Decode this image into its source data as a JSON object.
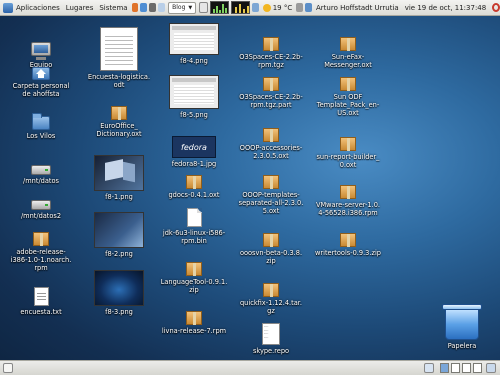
{
  "top_panel": {
    "menus": [
      "Aplicaciones",
      "Lugares",
      "Sistema"
    ],
    "combo_value": "Blog",
    "temperature": "19 °C",
    "user": "Arturo Hoffstadt Urrutia",
    "datetime": "vie 19 de oct, 11:37:48"
  },
  "desktop": {
    "col1": [
      {
        "label": "Equipo",
        "icon": "computer-icon"
      },
      {
        "label": "Carpeta personal\nde ahoffsta",
        "icon": "home-folder-icon"
      },
      {
        "label": "Los Vilos",
        "icon": "folder-icon"
      },
      {
        "label": "/mnt/datos",
        "icon": "drive-icon"
      },
      {
        "label": "/mnt/datos2",
        "icon": "drive-icon"
      },
      {
        "label": "adobe-release-\ni386-1.0-1.noarch.\nrpm",
        "icon": "package-icon"
      },
      {
        "label": "encuesta.txt",
        "icon": "text-file-icon"
      }
    ],
    "col2": [
      {
        "label": "Encuesta-logistica.\nodt",
        "icon": "document-icon"
      },
      {
        "label": "EuroOffice_\nDictionary.oxt",
        "icon": "package-icon"
      },
      {
        "label": "f8-1.png",
        "icon": "image-icon"
      },
      {
        "label": "f8-2.png",
        "icon": "image-icon"
      },
      {
        "label": "f8-3.png",
        "icon": "image-icon"
      }
    ],
    "col3": [
      {
        "label": "f8-4.png",
        "icon": "image-icon"
      },
      {
        "label": "f8-5.png",
        "icon": "image-icon"
      },
      {
        "label": "fedora8-1.jpg",
        "icon": "image-icon",
        "logo_text": "fedora"
      },
      {
        "label": "gdocs-0.4.1.oxt",
        "icon": "package-icon"
      },
      {
        "label": "jdk-6u3-linux-i586-\nrpm.bin",
        "icon": "binary-file-icon"
      },
      {
        "label": "LanguageTool-0.9.1.\nzip",
        "icon": "package-icon"
      },
      {
        "label": "livna-release-7.rpm",
        "icon": "package-icon"
      }
    ],
    "col4": [
      {
        "label": "O3Spaces-CE-2.2b-\nrpm.tgz",
        "icon": "package-icon"
      },
      {
        "label": "O3Spaces-CE-2.2b-\nrpm.tgz.part",
        "icon": "package-icon"
      },
      {
        "label": "OOOP-accessories-\n2.3.0.5.oxt",
        "icon": "package-icon"
      },
      {
        "label": "OOOP-templates-\nseparated-all-2.3.0.\n5.oxt",
        "icon": "package-icon"
      },
      {
        "label": "ooosvn-beta-0.3.8.\nzip",
        "icon": "package-icon"
      },
      {
        "label": "quickfix-1.12.4.tar.\ngz",
        "icon": "package-icon"
      },
      {
        "label": "skype.repo",
        "icon": "text-file-icon"
      }
    ],
    "col5": [
      {
        "label": "Sun-eFax-\nMessenger.oxt",
        "icon": "package-icon"
      },
      {
        "label": "Sun ODF\nTemplate_Pack_en-\nUS.oxt",
        "icon": "package-icon"
      },
      {
        "label": "sun-report-builder_\n0.oxt",
        "icon": "package-icon"
      },
      {
        "label": "VMware-server-1.0.\n4-56528.i386.rpm",
        "icon": "package-icon"
      },
      {
        "label": "writertools-0.9.3.zip",
        "icon": "package-icon"
      }
    ],
    "trash": {
      "label": "Papelera",
      "icon": "trash-icon"
    }
  },
  "colors": {
    "panel": "#dcdcd6",
    "desktop_bg": "#1d4a78",
    "folder": "#e9a840"
  }
}
